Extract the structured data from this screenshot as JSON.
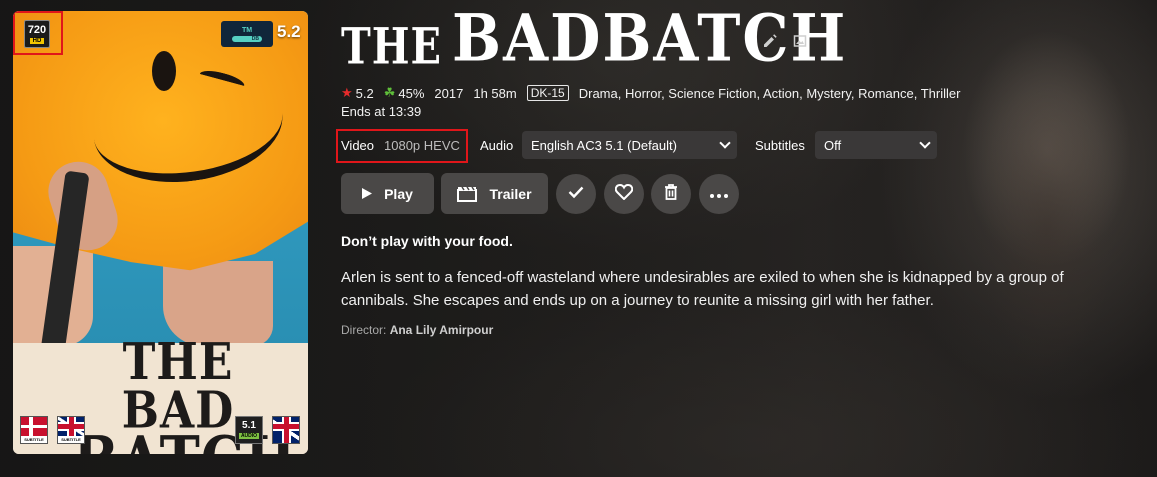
{
  "poster": {
    "title_line1": "THE BAD",
    "title_line2": "BATCH",
    "resolution_badge": "720",
    "resolution_sub": "HD",
    "tmdb_logo": "TM",
    "tmdb_logo_bar": "DB",
    "tmdb_score": "5.2",
    "audio_badge": "5.1",
    "audio_badge_label": "AUDIO",
    "subtitle_flag_label": "SUBTITLE"
  },
  "title": {
    "the": "THE",
    "main": "BADBATCH"
  },
  "meta": {
    "star_icon": "★",
    "community_rating": "5.2",
    "clover_icon": "☘",
    "critic_rating": "45%",
    "year": "2017",
    "runtime": "1h 58m",
    "official_rating": "DK-15",
    "genres": "Drama, Horror, Science Fiction, Action, Mystery, Romance, Thriller",
    "ends_at": "Ends at 13:39"
  },
  "streams": {
    "video_label": "Video",
    "video_value": "1080p HEVC",
    "audio_label": "Audio",
    "audio_value": "English AC3 5.1 (Default)",
    "subtitles_label": "Subtitles",
    "subtitles_value": "Off"
  },
  "actions": {
    "play_label": "Play",
    "trailer_label": "Trailer"
  },
  "tagline": "Don’t play with your food.",
  "overview": "Arlen is sent to a fenced-off wasteland where undesirables are exiled to when she is kidnapped by a group of cannibals. She escapes and ends up on a journey to reunite a missing girl with her father.",
  "director": {
    "label": "Director:",
    "name": "Ana Lily Amirpour"
  },
  "colors": {
    "accent_red": "#e0161a",
    "button_bg": "#4a4847",
    "star": "#e52b2b",
    "clover": "#5fbf3a"
  }
}
